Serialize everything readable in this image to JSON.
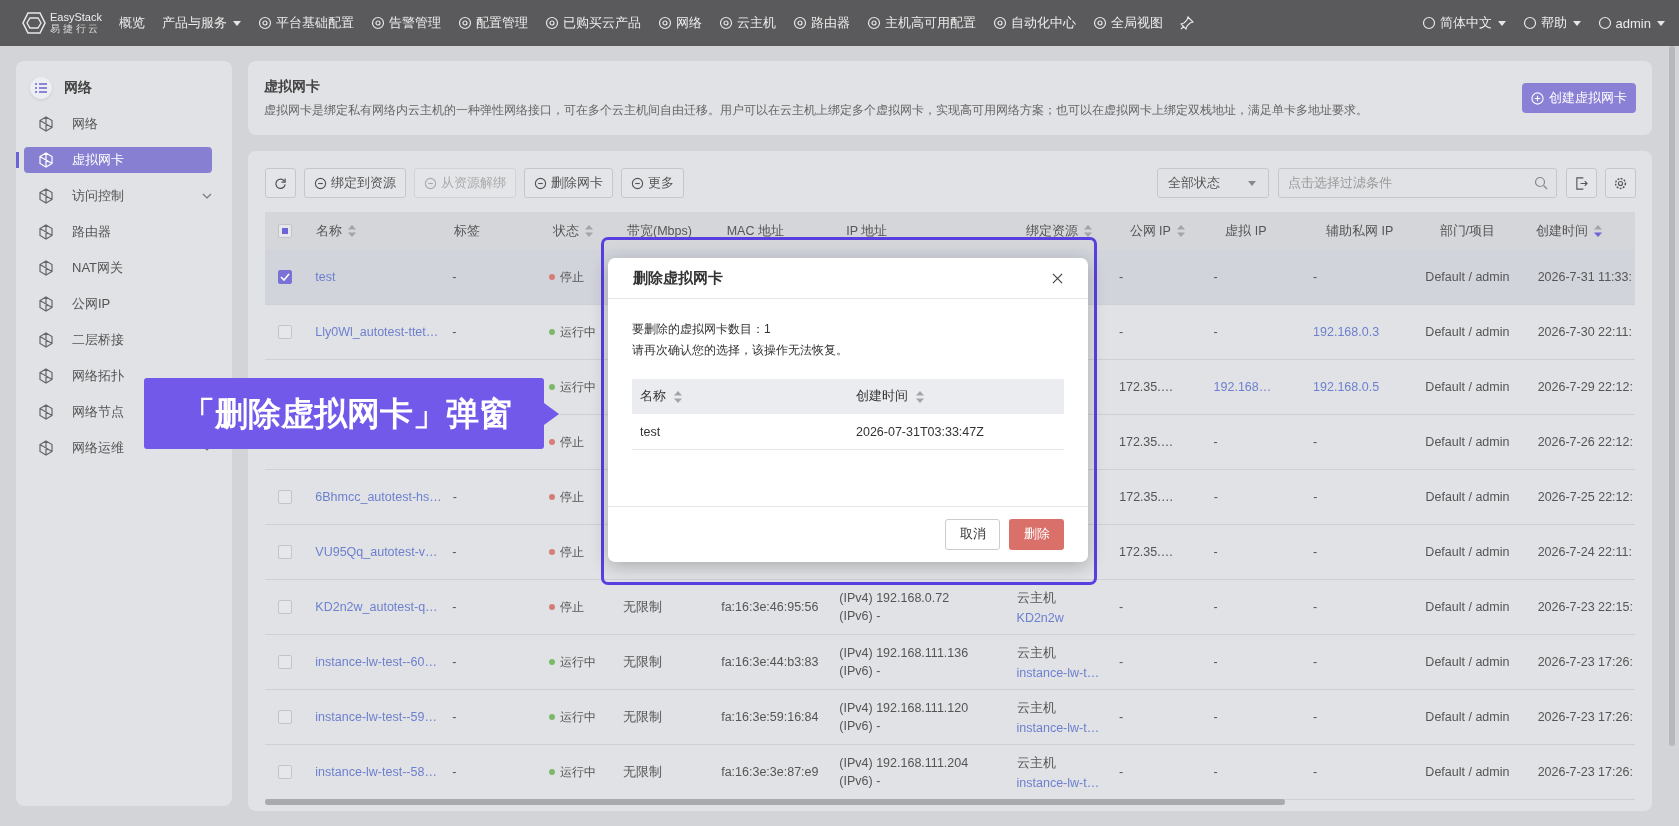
{
  "topbar": {
    "logo": {
      "name": "EasyStack",
      "tagline": "易 捷 行 云"
    },
    "nav": [
      {
        "label": "概览",
        "icon": false,
        "menu": false
      },
      {
        "label": "产品与服务",
        "icon": false,
        "menu": true
      },
      {
        "label": "平台基础配置",
        "icon": true,
        "menu": false
      },
      {
        "label": "告警管理",
        "icon": true,
        "menu": false
      },
      {
        "label": "配置管理",
        "icon": true,
        "menu": false
      },
      {
        "label": "已购买云产品",
        "icon": true,
        "menu": false
      },
      {
        "label": "网络",
        "icon": true,
        "menu": false
      },
      {
        "label": "云主机",
        "icon": true,
        "menu": false
      },
      {
        "label": "路由器",
        "icon": true,
        "menu": false
      },
      {
        "label": "主机高可用配置",
        "icon": true,
        "menu": false
      },
      {
        "label": "自动化中心",
        "icon": true,
        "menu": false
      },
      {
        "label": "全局视图",
        "icon": true,
        "menu": false
      }
    ],
    "right": [
      {
        "label": "简体中文",
        "menu": true
      },
      {
        "label": "帮助",
        "menu": true
      },
      {
        "label": "admin",
        "menu": true
      }
    ]
  },
  "sidebar": {
    "title": "网络",
    "items": [
      {
        "label": "网络",
        "selected": false,
        "expandable": false
      },
      {
        "label": "虚拟网卡",
        "selected": true,
        "expandable": false
      },
      {
        "label": "访问控制",
        "selected": false,
        "expandable": true
      },
      {
        "label": "路由器",
        "selected": false,
        "expandable": false
      },
      {
        "label": "NAT网关",
        "selected": false,
        "expandable": false
      },
      {
        "label": "公网IP",
        "selected": false,
        "expandable": false
      },
      {
        "label": "二层桥接",
        "selected": false,
        "expandable": false
      },
      {
        "label": "网络拓扑",
        "selected": false,
        "expandable": false
      },
      {
        "label": "网络节点",
        "selected": false,
        "expandable": false
      },
      {
        "label": "网络运维",
        "selected": false,
        "expandable": true
      }
    ]
  },
  "header": {
    "title": "虚拟网卡",
    "description": "虚拟网卡是绑定私有网络内云主机的一种弹性网络接口，可在多个云主机间自由迁移。用户可以在云主机上绑定多个虚拟网卡，实现高可用网络方案；也可以在虚拟网卡上绑定双栈地址，满足单卡多地址要求。",
    "create_button": "创建虚拟网卡"
  },
  "toolbar": {
    "buttons": [
      {
        "label": "绑定到资源",
        "disabled": false
      },
      {
        "label": "从资源解绑",
        "disabled": true
      },
      {
        "label": "删除网卡",
        "disabled": false
      },
      {
        "label": "更多",
        "disabled": false
      }
    ],
    "status_filter": "全部状态",
    "search": {
      "placeholder": "点击选择过滤条件"
    }
  },
  "table": {
    "select_all_indeterminate": true,
    "columns": [
      {
        "label": "名称",
        "sortable": true,
        "sorted": false
      },
      {
        "label": "标签",
        "sortable": false
      },
      {
        "label": "状态",
        "sortable": true,
        "sorted": false
      },
      {
        "label": "带宽(Mbps)",
        "sortable": false
      },
      {
        "label": "MAC 地址",
        "sortable": false
      },
      {
        "label": "IP 地址",
        "sortable": false
      },
      {
        "label": "绑定资源",
        "sortable": true,
        "sorted": false
      },
      {
        "label": "公网 IP",
        "sortable": true,
        "sorted": false
      },
      {
        "label": "虚拟 IP",
        "sortable": false
      },
      {
        "label": "辅助私网 IP",
        "sortable": false
      },
      {
        "label": "部门/项目",
        "sortable": false
      },
      {
        "label": "创建时间",
        "sortable": true,
        "sorted": true
      }
    ],
    "rows": [
      {
        "selected": true,
        "name": "test",
        "tag": "-",
        "status": {
          "text": "停止",
          "kind": "stopped"
        },
        "public_ip": {
          "text": "-",
          "link": false
        },
        "virtual_ip": {
          "text": "-",
          "link": false
        },
        "secondary_ip": {
          "text": "-",
          "link": false
        },
        "dept": "Default / admin",
        "created": "2026-7-31 11:33:"
      },
      {
        "selected": false,
        "name": "Lly0Wl_autotest-ttet…",
        "tag": "-",
        "status": {
          "text": "运行中",
          "kind": "running"
        },
        "public_ip": {
          "text": "-",
          "link": false
        },
        "virtual_ip": {
          "text": "-",
          "link": false
        },
        "secondary_ip": {
          "text": "192.168.0.3",
          "link": true
        },
        "dept": "Default / admin",
        "created": "2026-7-30 22:11:"
      },
      {
        "status": {
          "text": "运行中",
          "kind": "running"
        },
        "public_ip": {
          "text": "172.35.…",
          "link": false
        },
        "virtual_ip": {
          "text": "192.168…",
          "link": true
        },
        "secondary_ip": {
          "text": "192.168.0.5",
          "link": true
        },
        "dept": "Default / admin",
        "created": "2026-7-29 22:12:"
      },
      {
        "status": {
          "text": "停止",
          "kind": "stopped"
        },
        "public_ip": {
          "text": "172.35.…",
          "link": false
        },
        "virtual_ip": {
          "text": "-",
          "link": false
        },
        "secondary_ip": {
          "text": "-",
          "link": false
        },
        "dept": "Default / admin",
        "created": "2026-7-26 22:12:"
      },
      {
        "selected": false,
        "name": "6Bhmcc_autotest-hs…",
        "tag": "-",
        "status": {
          "text": "停止",
          "kind": "stopped"
        },
        "public_ip": {
          "text": "172.35.…",
          "link": false
        },
        "virtual_ip": {
          "text": "-",
          "link": false
        },
        "secondary_ip": {
          "text": "-",
          "link": false
        },
        "dept": "Default / admin",
        "created": "2026-7-25 22:12:"
      },
      {
        "selected": false,
        "name": "VU95Qq_autotest-v…",
        "tag": "-",
        "status": {
          "text": "停止",
          "kind": "stopped"
        },
        "public_ip": {
          "text": "172.35.…",
          "link": false
        },
        "virtual_ip": {
          "text": "-",
          "link": false
        },
        "secondary_ip": {
          "text": "-",
          "link": false
        },
        "dept": "Default / admin",
        "created": "2026-7-24 22:11:"
      },
      {
        "selected": false,
        "name": "KD2n2w_autotest-q…",
        "tag": "-",
        "status": {
          "text": "停止",
          "kind": "stopped"
        },
        "bandwidth": "无限制",
        "mac": "fa:16:3e:46:95:56",
        "ip": [
          "(IPv4) 192.168.0.72",
          "(IPv6) -"
        ],
        "bound": {
          "type": "云主机",
          "name": "KD2n2w"
        },
        "public_ip": {
          "text": "-",
          "link": false
        },
        "virtual_ip": {
          "text": "-",
          "link": false
        },
        "secondary_ip": {
          "text": "-",
          "link": false
        },
        "dept": "Default / admin",
        "created": "2026-7-23 22:15:"
      },
      {
        "selected": false,
        "name": "instance-lw-test--60…",
        "tag": "-",
        "status": {
          "text": "运行中",
          "kind": "running"
        },
        "bandwidth": "无限制",
        "mac": "fa:16:3e:44:b3:83",
        "ip": [
          "(IPv4) 192.168.111.136",
          "(IPv6) -"
        ],
        "bound": {
          "type": "云主机",
          "name": "instance-lw-t…"
        },
        "public_ip": {
          "text": "-",
          "link": false
        },
        "virtual_ip": {
          "text": "-",
          "link": false
        },
        "secondary_ip": {
          "text": "-",
          "link": false
        },
        "dept": "Default / admin",
        "created": "2026-7-23 17:26:"
      },
      {
        "selected": false,
        "name": "instance-lw-test--59…",
        "tag": "-",
        "status": {
          "text": "运行中",
          "kind": "running"
        },
        "bandwidth": "无限制",
        "mac": "fa:16:3e:59:16:84",
        "ip": [
          "(IPv4) 192.168.111.120",
          "(IPv6) -"
        ],
        "bound": {
          "type": "云主机",
          "name": "instance-lw-t…"
        },
        "public_ip": {
          "text": "-",
          "link": false
        },
        "virtual_ip": {
          "text": "-",
          "link": false
        },
        "secondary_ip": {
          "text": "-",
          "link": false
        },
        "dept": "Default / admin",
        "created": "2026-7-23 17:26:"
      },
      {
        "selected": false,
        "name": "instance-lw-test--58…",
        "tag": "-",
        "status": {
          "text": "运行中",
          "kind": "running"
        },
        "bandwidth": "无限制",
        "mac": "fa:16:3e:3e:87:e9",
        "ip": [
          "(IPv4) 192.168.111.204",
          "(IPv6) -"
        ],
        "bound": {
          "type": "云主机",
          "name": "instance-lw-t…"
        },
        "public_ip": {
          "text": "-",
          "link": false
        },
        "virtual_ip": {
          "text": "-",
          "link": false
        },
        "secondary_ip": {
          "text": "-",
          "link": false
        },
        "dept": "Default / admin",
        "created": "2026-7-23 17:26:"
      }
    ]
  },
  "dialog": {
    "title": "删除虚拟网卡",
    "lines": [
      "要删除的虚拟网卡数目：1",
      "请再次确认您的选择，该操作无法恢复。"
    ],
    "columns": [
      {
        "label": "名称",
        "sortable": true,
        "sorted": false
      },
      {
        "label": "创建时间",
        "sortable": true,
        "sorted": false
      }
    ],
    "rows": [
      {
        "name": "test",
        "created": "2026-07-31T03:33:47Z"
      }
    ],
    "cancel": "取消",
    "confirm": "删除"
  },
  "callout": "「删除虚拟网卡」弹窗"
}
